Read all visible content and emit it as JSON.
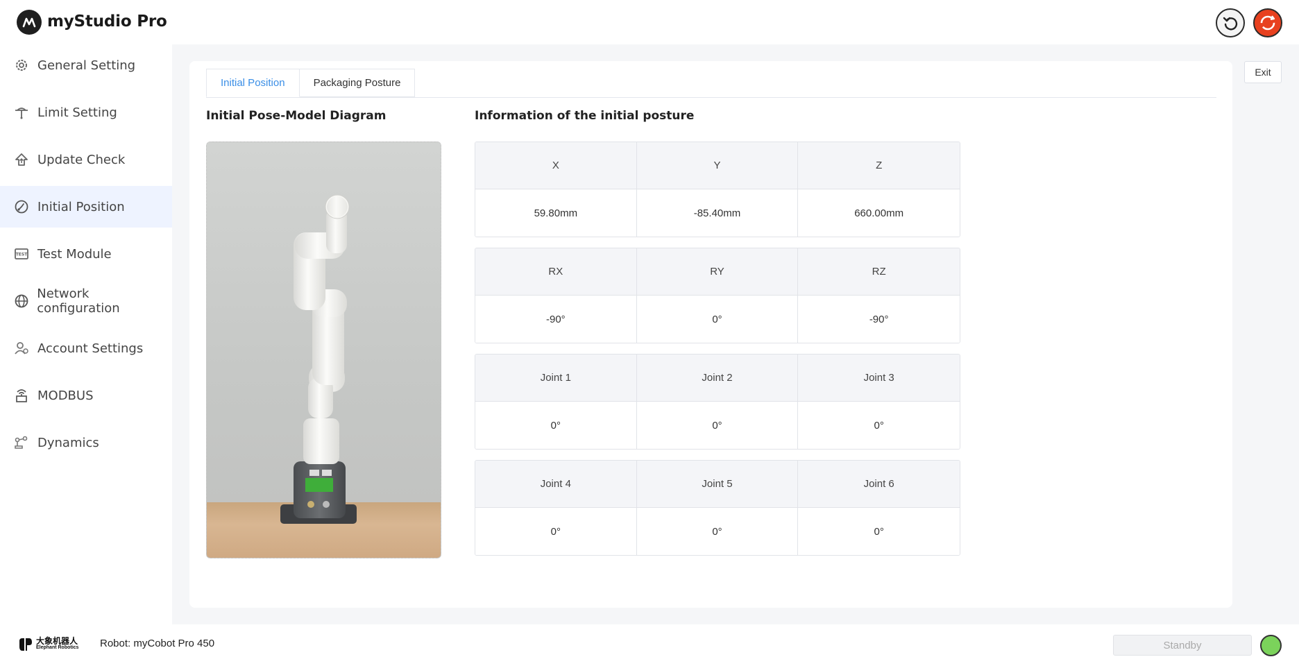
{
  "app": {
    "title": "myStudio Pro"
  },
  "sidebar": {
    "items": [
      {
        "label": "General Setting",
        "icon": "gear-icon"
      },
      {
        "label": "Limit Setting",
        "icon": "limit-icon"
      },
      {
        "label": "Update Check",
        "icon": "update-icon"
      },
      {
        "label": "Initial Position",
        "icon": "initial-position-icon",
        "active": true
      },
      {
        "label": "Test Module",
        "icon": "test-icon"
      },
      {
        "label": "Network configuration",
        "icon": "globe-icon"
      },
      {
        "label": "Account Settings",
        "icon": "account-icon"
      },
      {
        "label": "MODBUS",
        "icon": "modbus-icon"
      },
      {
        "label": "Dynamics",
        "icon": "dynamics-icon"
      }
    ]
  },
  "main": {
    "tabs": [
      {
        "label": "Initial Position",
        "active": true
      },
      {
        "label": "Packaging Posture",
        "active": false
      }
    ],
    "exit_label": "Exit",
    "diagram_title": "Initial Pose-Model Diagram",
    "info_title": "Information of the initial posture",
    "grids": [
      {
        "headers": [
          "X",
          "Y",
          "Z"
        ],
        "values": [
          "59.80mm",
          "-85.40mm",
          "660.00mm"
        ]
      },
      {
        "headers": [
          "RX",
          "RY",
          "RZ"
        ],
        "values": [
          "-90°",
          "0°",
          "-90°"
        ]
      },
      {
        "headers": [
          "Joint 1",
          "Joint 2",
          "Joint 3"
        ],
        "values": [
          "0°",
          "0°",
          "0°"
        ]
      },
      {
        "headers": [
          "Joint 4",
          "Joint 5",
          "Joint 6"
        ],
        "values": [
          "0°",
          "0°",
          "0°"
        ]
      }
    ]
  },
  "footer": {
    "brand_cn": "大象机器人",
    "brand_en": "Elephant Robotics",
    "robot_label": "Robot: myCobot Pro 450",
    "standby_label": "Standby",
    "status_color": "#7bd35b"
  },
  "colors": {
    "accent": "#3a8ee6",
    "active_nav_bg": "#eef3ff",
    "power_button": "#e8411f"
  }
}
